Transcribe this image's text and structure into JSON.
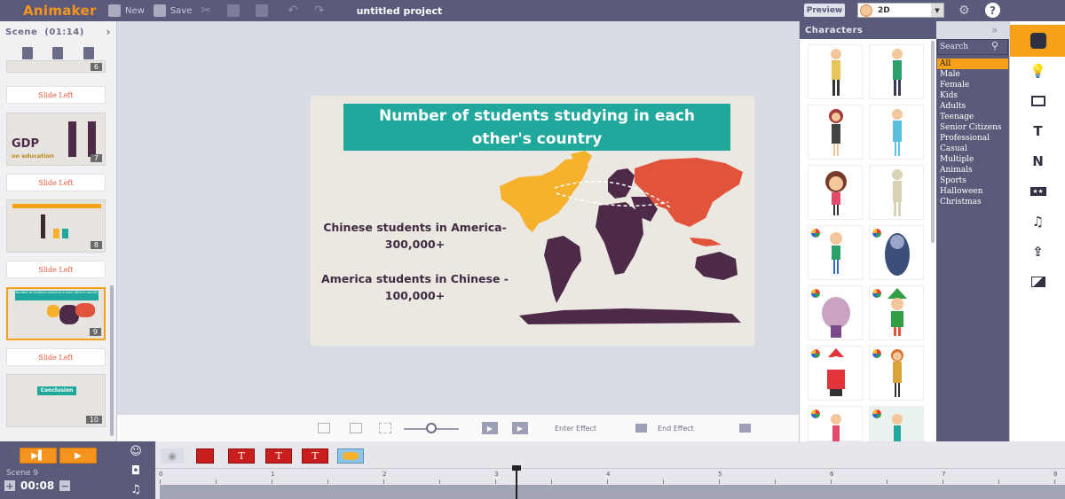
{
  "app": {
    "logo": "Animaker",
    "project_title": "untitled project",
    "preview_label": "Preview",
    "mode_value": "2D"
  },
  "toolbar": {
    "new_label": "New",
    "save_label": "Save"
  },
  "scene_panel": {
    "header": "Scene",
    "duration": "(01:14)",
    "slides": [
      {
        "number": "6",
        "transition": "Slide Left"
      },
      {
        "number": "7",
        "transition": "Slide Left",
        "thumb_title": "GDP",
        "thumb_sub": "on education"
      },
      {
        "number": "8",
        "transition": "Slide Left"
      },
      {
        "number": "9",
        "transition": "Slide Left",
        "thumb_title": "Number of students studying in each other's country"
      },
      {
        "number": "10",
        "thumb_title": "Conclusion"
      }
    ]
  },
  "stage": {
    "title": "Number of students studying in each other's country",
    "stat1_line1": "Chinese students in America-",
    "stat1_line2": "300,000+",
    "stat2_line1": "America students in Chinese -",
    "stat2_line2": "100,000+",
    "colors": {
      "title_bg": "#21a89c",
      "americas": "#f7b22d",
      "asia": "#e2533b",
      "other": "#4e2a49"
    }
  },
  "canvas_toolbar": {
    "enter_effect": "Enter Effect",
    "end_effect": "End Effect"
  },
  "characters_panel": {
    "header": "Characters",
    "search_placeholder": "Search",
    "categories": [
      "All",
      "Male",
      "Female",
      "Kids",
      "Adults",
      "Teenage",
      "Senior Citizens",
      "Professional",
      "Casual",
      "Multiple",
      "Animals",
      "Sports",
      "Halloween",
      "Christmas"
    ],
    "selected_category": "All"
  },
  "rail": {
    "text_label": "T",
    "n_label": "N"
  },
  "timeline": {
    "scene_label": "Scene 9",
    "time": "00:08",
    "track_t_label": "T",
    "ruler_labels": [
      "0",
      "1",
      "2",
      "3",
      "4",
      "5",
      "6",
      "7",
      "8"
    ]
  }
}
